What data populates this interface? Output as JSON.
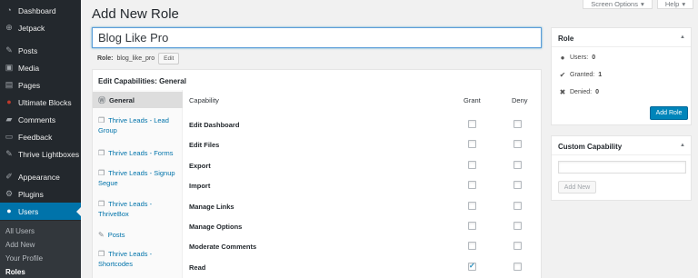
{
  "sidebar": {
    "items": [
      {
        "icon": "dashboard-icon",
        "glyph": "◔",
        "label": "Dashboard"
      },
      {
        "icon": "jetpack-icon",
        "glyph": "⊕",
        "label": "Jetpack"
      },
      {
        "icon": "pin-icon",
        "glyph": "✎",
        "label": "Posts"
      },
      {
        "icon": "media-icon",
        "glyph": "▣",
        "label": "Media"
      },
      {
        "icon": "pages-icon",
        "glyph": "▤",
        "label": "Pages"
      },
      {
        "icon": "ultimate-blocks-icon",
        "glyph": "●",
        "label": "Ultimate Blocks"
      },
      {
        "icon": "comments-icon",
        "glyph": "▰",
        "label": "Comments"
      },
      {
        "icon": "feedback-icon",
        "glyph": "▭",
        "label": "Feedback"
      },
      {
        "icon": "lightbox-pin-icon",
        "glyph": "✎",
        "label": "Thrive Lightboxes"
      },
      {
        "icon": "appearance-icon",
        "glyph": "✐",
        "label": "Appearance"
      },
      {
        "icon": "plugins-icon",
        "glyph": "⚙",
        "label": "Plugins"
      },
      {
        "icon": "users-icon",
        "glyph": "●",
        "label": "Users"
      }
    ],
    "submenu": [
      "All Users",
      "Add New",
      "Your Profile",
      "Roles"
    ]
  },
  "screen_options_label": "Screen Options",
  "help_label": "Help",
  "page_title": "Add New Role",
  "role_name": "Blog Like Pro",
  "role_slug": {
    "label": "Role:",
    "value": "blog_like_pro",
    "edit_label": "Edit"
  },
  "capabilities": {
    "title": "Edit Capabilities: General",
    "nav": [
      {
        "label": "General",
        "icon": "wordpress-icon",
        "glyph": "Ⓦ"
      },
      {
        "label": "Thrive Leads - Lead Group",
        "icon": "thrive-leads-icon",
        "glyph": "❒"
      },
      {
        "label": "Thrive Leads - Forms",
        "icon": "thrive-leads-icon",
        "glyph": "❒"
      },
      {
        "label": "Thrive Leads - Signup Segue",
        "icon": "thrive-leads-icon",
        "glyph": "❒"
      },
      {
        "label": "Thrive Leads - ThriveBox",
        "icon": "thrive-leads-icon",
        "glyph": "❒"
      },
      {
        "label": "Posts",
        "icon": "pin-icon",
        "glyph": "✎"
      },
      {
        "label": "Thrive Leads - Shortcodes",
        "icon": "thrive-leads-icon",
        "glyph": "❒"
      }
    ],
    "columns": {
      "capability": "Capability",
      "grant": "Grant",
      "deny": "Deny"
    },
    "rows": [
      {
        "label": "Edit Dashboard",
        "grant": false,
        "deny": false
      },
      {
        "label": "Edit Files",
        "grant": false,
        "deny": false
      },
      {
        "label": "Export",
        "grant": false,
        "deny": false
      },
      {
        "label": "Import",
        "grant": false,
        "deny": false
      },
      {
        "label": "Manage Links",
        "grant": false,
        "deny": false
      },
      {
        "label": "Manage Options",
        "grant": false,
        "deny": false
      },
      {
        "label": "Moderate Comments",
        "grant": false,
        "deny": false
      },
      {
        "label": "Read",
        "grant": true,
        "deny": false
      }
    ]
  },
  "role_box": {
    "title": "Role",
    "users_label": "Users:",
    "users_value": "0",
    "granted_label": "Granted:",
    "granted_value": "1",
    "denied_label": "Denied:",
    "denied_value": "0",
    "add_role_label": "Add Role"
  },
  "custom_cap": {
    "title": "Custom Capability",
    "input_value": "",
    "add_new_label": "Add New"
  }
}
